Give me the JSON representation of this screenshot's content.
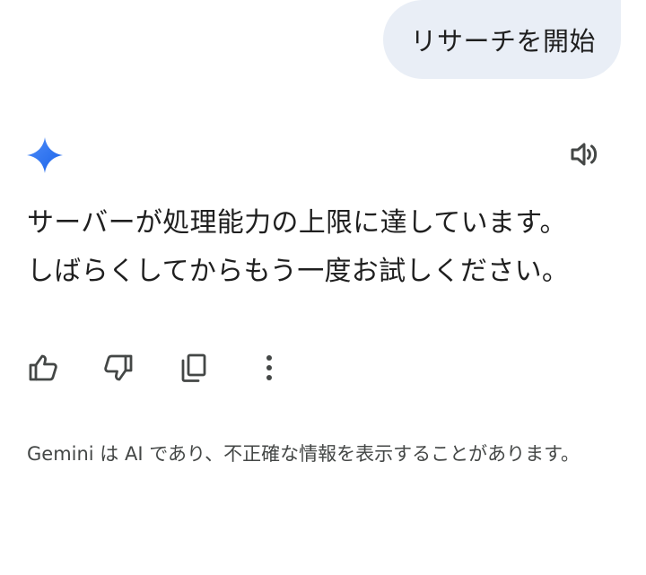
{
  "user_message": {
    "text": "リサーチを開始"
  },
  "response": {
    "assistant_icon": "gemini-sparkle-icon",
    "speaker_icon": "volume-icon",
    "lines": [
      "サーバーが処理能力の上限に達しています。",
      "しばらくしてからもう一度お試しください。"
    ]
  },
  "actions": [
    {
      "name": "thumbs-up-button",
      "icon": "thumbs-up-icon"
    },
    {
      "name": "thumbs-down-button",
      "icon": "thumbs-down-icon"
    },
    {
      "name": "copy-button",
      "icon": "copy-icon"
    },
    {
      "name": "more-options-button",
      "icon": "more-vert-icon"
    }
  ],
  "disclaimer": {
    "text": "Gemini は AI であり、不正確な情報を表示することがあります。"
  },
  "colors": {
    "user_bubble": "#e9eef6",
    "text_primary": "#1f1f1f",
    "text_secondary": "#444746",
    "icon": "#444746",
    "sparkle_start": "#4285f4",
    "sparkle_end": "#1a73e8"
  }
}
